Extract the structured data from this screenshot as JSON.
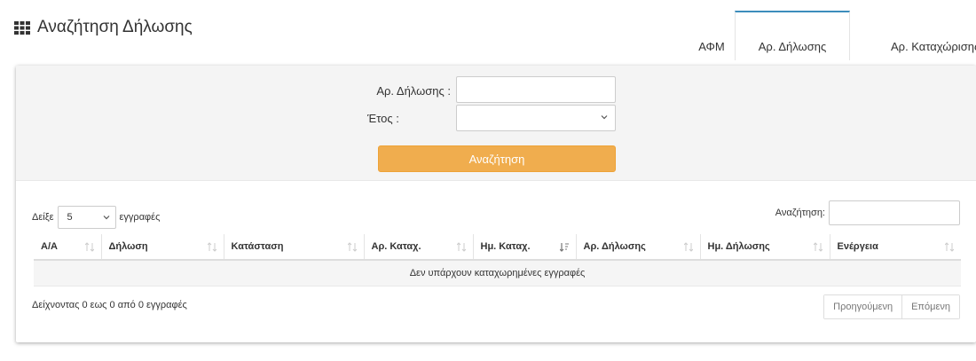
{
  "header": {
    "title": "Αναζήτηση Δήλωσης",
    "icon": "grid-icon"
  },
  "tabs": [
    {
      "label": "ΑΦΜ",
      "active": false
    },
    {
      "label": "Αρ. Δήλωσης",
      "active": true
    },
    {
      "label": "Αρ. Καταχώρισης",
      "active": false
    }
  ],
  "form": {
    "ar_dilosis_label": "Αρ. Δήλωσης :",
    "ar_dilosis_value": "",
    "etos_label": "Έτος :",
    "etos_value": "",
    "search_button": "Αναζήτηση"
  },
  "table_controls": {
    "show_label": "Δείξε",
    "page_length": "5",
    "records_label": "εγγραφές",
    "search_label": "Αναζήτηση:",
    "search_value": ""
  },
  "table": {
    "columns": [
      "Α/Α",
      "Δήλωση",
      "Κατάσταση",
      "Αρ. Καταχ.",
      "Ημ. Καταχ.",
      "Αρ. Δήλωσης",
      "Ημ. Δήλωσης",
      "Ενέργεια"
    ],
    "empty_message": "Δεν υπάρχουν καταχωρημένες εγγραφές"
  },
  "info": "Δείχνοντας 0 εως 0 από 0 εγγραφές",
  "pagination": {
    "prev": "Προηγούμενη",
    "next": "Επόμενη"
  },
  "colors": {
    "accent": "#3c8dbc",
    "button": "#f0ad4e",
    "panel": "#f4f4f4"
  }
}
